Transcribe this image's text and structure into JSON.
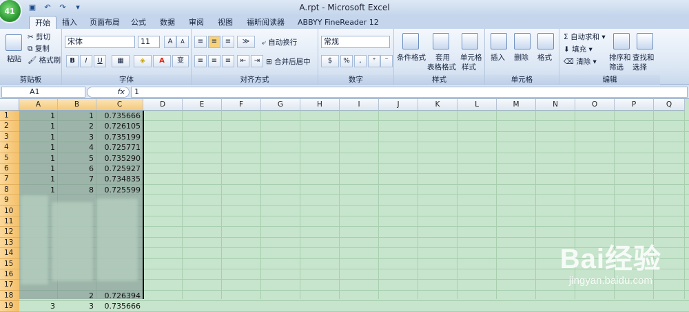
{
  "title": "A.rpt - Microsoft Excel",
  "office_button": "41",
  "tabs": [
    "开始",
    "插入",
    "页面布局",
    "公式",
    "数据",
    "审阅",
    "视图",
    "福昕阅读器",
    "ABBYY FineReader 12"
  ],
  "clipboard": {
    "paste": "粘贴",
    "cut": "剪切",
    "copy": "复制",
    "format_painter": "格式刷",
    "label": "剪贴板"
  },
  "font": {
    "name": "宋体",
    "size": "11",
    "bold": "B",
    "italic": "I",
    "underline": "U",
    "label": "字体",
    "grow": "A",
    "shrink": "A",
    "phonetic": "变"
  },
  "alignment": {
    "wrap": "自动换行",
    "merge": "合并后居中",
    "label": "对齐方式"
  },
  "number": {
    "format": "常规",
    "percent": "%",
    "comma": ",",
    "label": "数字"
  },
  "styles": {
    "cond": "条件格式",
    "table1": "套用",
    "table2": "表格格式",
    "cell1": "单元格",
    "cell2": "样式",
    "label": "样式"
  },
  "cells": {
    "insert": "插入",
    "delete": "删除",
    "format": "格式",
    "label": "单元格"
  },
  "editing": {
    "autosum": "自动求和",
    "fill": "填充",
    "clear": "清除",
    "sort1": "排序和",
    "sort2": "筛选",
    "find1": "查找和",
    "find2": "选择",
    "label": "编辑"
  },
  "formula_bar": {
    "name_box": "A1",
    "fx": "fx",
    "value": "1"
  },
  "columns": [
    "A",
    "B",
    "C",
    "D",
    "E",
    "F",
    "G",
    "H",
    "I",
    "J",
    "K",
    "L",
    "M",
    "N",
    "O",
    "P",
    "Q"
  ],
  "rows": [
    "1",
    "2",
    "3",
    "4",
    "5",
    "6",
    "7",
    "8",
    "9",
    "10",
    "11",
    "12",
    "13",
    "14",
    "15",
    "16",
    "17",
    "18",
    "19"
  ],
  "data_rows": [
    {
      "a": "1",
      "b": "1",
      "c": "0.735666"
    },
    {
      "a": "1",
      "b": "2",
      "c": "0.726105"
    },
    {
      "a": "1",
      "b": "3",
      "c": "0.735199"
    },
    {
      "a": "1",
      "b": "4",
      "c": "0.725771"
    },
    {
      "a": "1",
      "b": "5",
      "c": "0.735290"
    },
    {
      "a": "1",
      "b": "6",
      "c": "0.725927"
    },
    {
      "a": "1",
      "b": "7",
      "c": "0.734835"
    },
    {
      "a": "1",
      "b": "8",
      "c": "0.725599"
    }
  ],
  "tail_rows": [
    {
      "row": 18,
      "b": "2",
      "c": "0.726394"
    },
    {
      "row": 19,
      "a": "3",
      "b": "3",
      "c": "0.735666"
    }
  ],
  "watermark": {
    "brand": "Bai经验",
    "url": "jingyan.baidu.com"
  },
  "colors": {
    "sheet_bg": "#c7e4cc",
    "ribbon": "#dbe6f4",
    "row_header": "#f4c06a"
  }
}
